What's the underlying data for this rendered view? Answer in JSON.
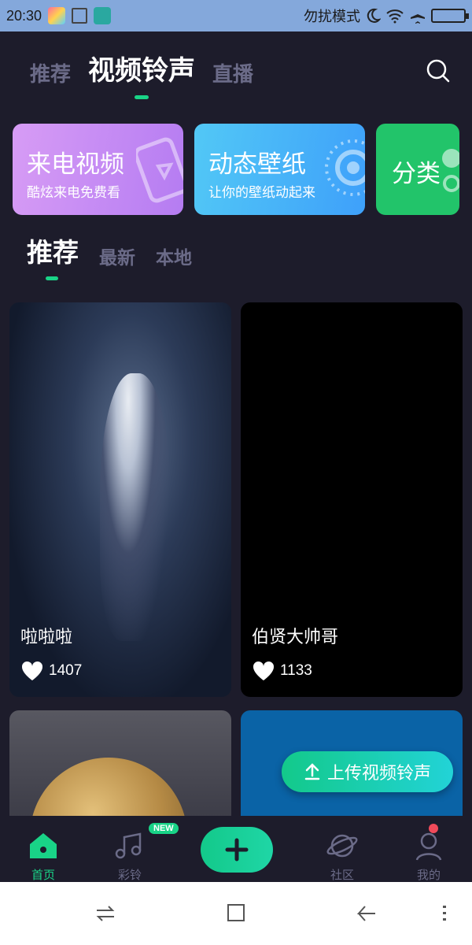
{
  "status_bar": {
    "time": "20:30",
    "dnd_label": "勿扰模式",
    "icons": [
      "app-icon",
      "cleaner-icon",
      "usb-icon",
      "moon-icon",
      "wifi-icon",
      "airplane-icon",
      "battery-icon"
    ]
  },
  "top_tabs": [
    {
      "label": "推荐",
      "active": false
    },
    {
      "label": "视频铃声",
      "active": true
    },
    {
      "label": "直播",
      "active": false
    }
  ],
  "banners": {
    "video": {
      "title": "来电视频",
      "subtitle": "酷炫来电免费看"
    },
    "wallpaper": {
      "title": "动态壁纸",
      "subtitle": "让你的壁纸动起来"
    },
    "category": {
      "title": "分类"
    }
  },
  "sub_tabs": [
    {
      "label": "推荐",
      "active": true
    },
    {
      "label": "最新",
      "active": false
    },
    {
      "label": "本地",
      "active": false
    }
  ],
  "videos": [
    {
      "title": "啦啦啦",
      "likes": "1407"
    },
    {
      "title": "伯贤大帅哥",
      "likes": "1133"
    }
  ],
  "upload_button": {
    "label": "上传视频铃声"
  },
  "bottom_nav": {
    "home": "首页",
    "ringtone": "彩铃",
    "new_badge": "NEW",
    "community": "社区",
    "mine": "我的"
  },
  "colors": {
    "background": "#1d1c2b",
    "accent": "#19d387",
    "inactive_text": "#6b6b88",
    "badge_red": "#f04a5a"
  }
}
